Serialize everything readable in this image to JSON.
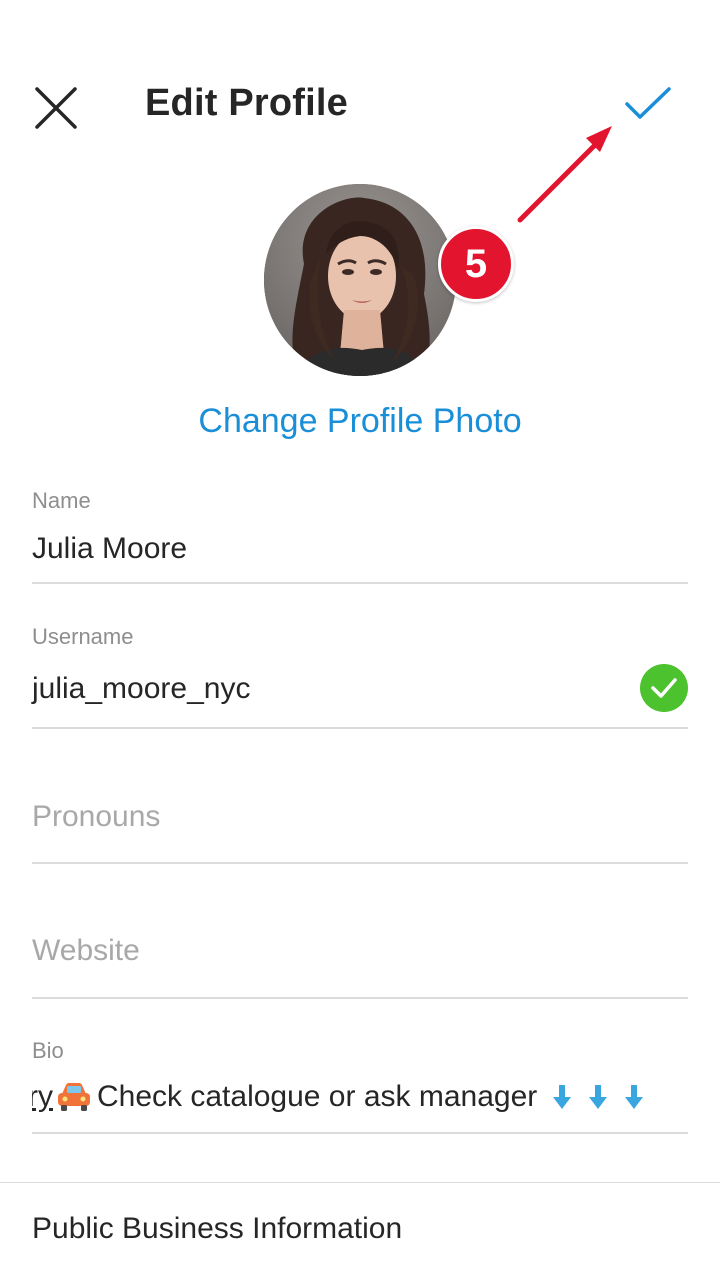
{
  "header": {
    "title": "Edit Profile",
    "close_icon": "close-icon",
    "done_icon": "checkmark-icon"
  },
  "profile": {
    "change_photo_label": "Change Profile Photo"
  },
  "annotation": {
    "step_number": "5",
    "color": "#e3142e"
  },
  "fields": {
    "name": {
      "label": "Name",
      "value": "Julia Moore"
    },
    "username": {
      "label": "Username",
      "value": "julia_moore_nyc",
      "status_icon": "valid-check-icon"
    },
    "pronouns": {
      "placeholder": "Pronouns"
    },
    "website": {
      "placeholder": "Website"
    },
    "bio": {
      "label": "Bio",
      "value_prefix": "ry",
      "value": "Check catalogue or ask manager"
    }
  },
  "sections": {
    "public_business_info": "Public Business Information"
  },
  "colors": {
    "accent": "#1a8fd8",
    "valid_green": "#4cc22e",
    "divider": "#dbdbdb"
  }
}
